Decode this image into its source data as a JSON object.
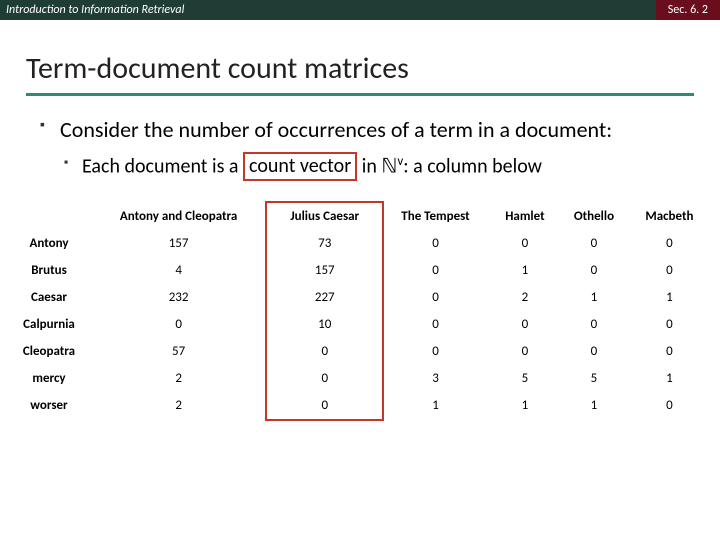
{
  "header": {
    "left": "Introduction to Information Retrieval",
    "right": "Sec. 6. 2"
  },
  "title": "Term-document count matrices",
  "bullets": {
    "main": "Consider the number of occurrences of a term in a document:",
    "sub_prefix": "Each document is a ",
    "sub_box": "count vector",
    "sub_mid": " in ",
    "sub_sym": "ℕ",
    "sub_sup": "v",
    "sub_suffix": ": a column below"
  },
  "table": {
    "columns": [
      "Antony and Cleopatra",
      "Julius Caesar",
      "The Tempest",
      "Hamlet",
      "Othello",
      "Macbeth"
    ],
    "rows": [
      {
        "term": "Antony",
        "vals": [
          "157",
          "73",
          "0",
          "0",
          "0",
          "0"
        ]
      },
      {
        "term": "Brutus",
        "vals": [
          "4",
          "157",
          "0",
          "1",
          "0",
          "0"
        ]
      },
      {
        "term": "Caesar",
        "vals": [
          "232",
          "227",
          "0",
          "2",
          "1",
          "1"
        ]
      },
      {
        "term": "Calpurnia",
        "vals": [
          "0",
          "10",
          "0",
          "0",
          "0",
          "0"
        ]
      },
      {
        "term": "Cleopatra",
        "vals": [
          "57",
          "0",
          "0",
          "0",
          "0",
          "0"
        ]
      },
      {
        "term": "mercy",
        "vals": [
          "2",
          "0",
          "3",
          "5",
          "5",
          "1"
        ]
      },
      {
        "term": "worser",
        "vals": [
          "2",
          "0",
          "1",
          "1",
          "1",
          "0"
        ]
      }
    ]
  },
  "chart_data": {
    "type": "table",
    "title": "Term-document count matrices",
    "row_labels": [
      "Antony",
      "Brutus",
      "Caesar",
      "Calpurnia",
      "Cleopatra",
      "mercy",
      "worser"
    ],
    "col_labels": [
      "Antony and Cleopatra",
      "Julius Caesar",
      "The Tempest",
      "Hamlet",
      "Othello",
      "Macbeth"
    ],
    "values": [
      [
        157,
        73,
        0,
        0,
        0,
        0
      ],
      [
        4,
        157,
        0,
        1,
        0,
        0
      ],
      [
        232,
        227,
        0,
        2,
        1,
        1
      ],
      [
        0,
        10,
        0,
        0,
        0,
        0
      ],
      [
        57,
        0,
        0,
        0,
        0,
        0
      ],
      [
        2,
        0,
        3,
        5,
        5,
        1
      ],
      [
        2,
        0,
        1,
        1,
        1,
        0
      ]
    ]
  }
}
